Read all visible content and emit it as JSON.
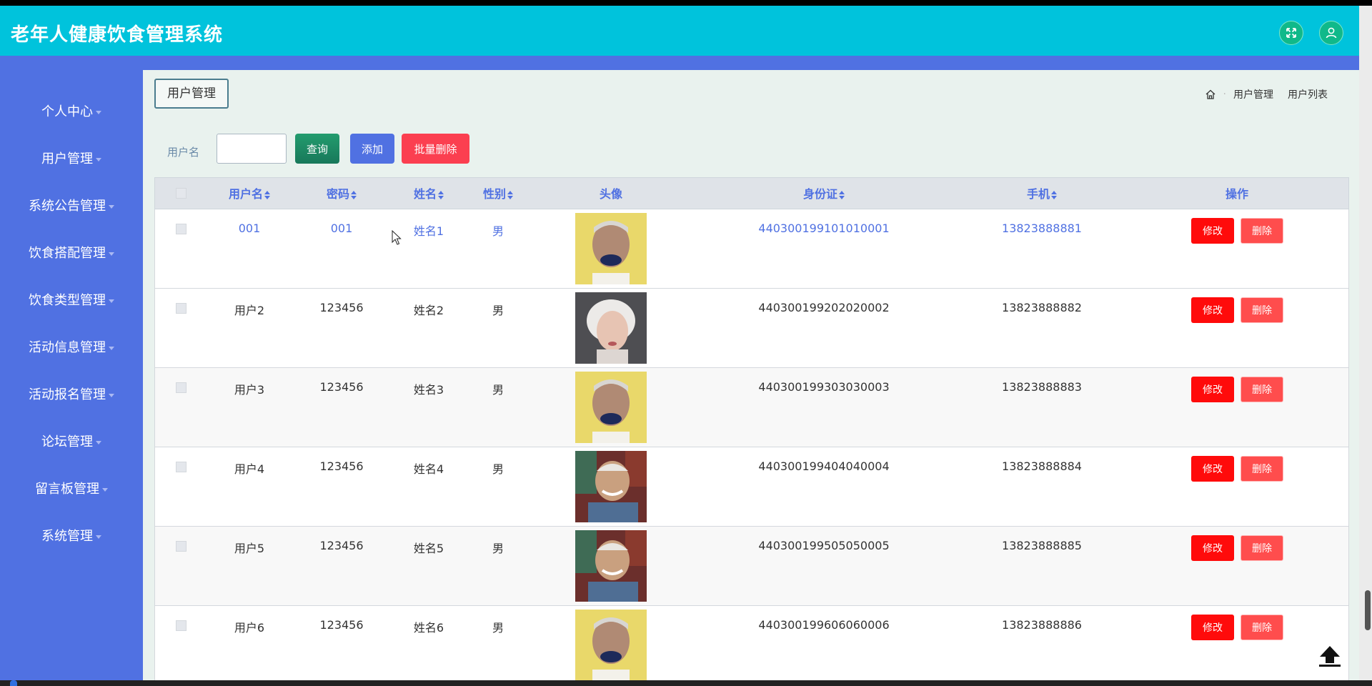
{
  "app": {
    "title": "老年人健康饮食管理系统"
  },
  "sidebar": {
    "items": [
      {
        "label": "个人中心"
      },
      {
        "label": "用户管理"
      },
      {
        "label": "系统公告管理"
      },
      {
        "label": "饮食搭配管理"
      },
      {
        "label": "饮食类型管理"
      },
      {
        "label": "活动信息管理"
      },
      {
        "label": "活动报名管理"
      },
      {
        "label": "论坛管理"
      },
      {
        "label": "留言板管理"
      },
      {
        "label": "系统管理"
      }
    ]
  },
  "page": {
    "tag": "用户管理",
    "breadcrumb": [
      "用户管理",
      "用户列表"
    ]
  },
  "filter": {
    "label": "用户名",
    "value": "",
    "query_label": "查询",
    "add_label": "添加",
    "bulk_delete_label": "批量删除"
  },
  "table": {
    "columns": [
      "用户名",
      "密码",
      "姓名",
      "性别",
      "头像",
      "身份证",
      "手机",
      "操作"
    ],
    "edit_label": "修改",
    "delete_label": "删除",
    "rows": [
      {
        "username": "001",
        "password": "001",
        "name": "姓名1",
        "gender": "男",
        "avatar": "elderly-man-yellow-bg",
        "id_card": "440300199101010001",
        "phone": "13823888881"
      },
      {
        "username": "用户2",
        "password": "123456",
        "name": "姓名2",
        "gender": "男",
        "avatar": "elderly-woman-grey-bg",
        "id_card": "440300199202020002",
        "phone": "13823888882"
      },
      {
        "username": "用户3",
        "password": "123456",
        "name": "姓名3",
        "gender": "男",
        "avatar": "elderly-man-yellow-bg",
        "id_card": "440300199303030003",
        "phone": "13823888883"
      },
      {
        "username": "用户4",
        "password": "123456",
        "name": "姓名4",
        "gender": "男",
        "avatar": "smiling-elderly-man",
        "id_card": "440300199404040004",
        "phone": "13823888884"
      },
      {
        "username": "用户5",
        "password": "123456",
        "name": "姓名5",
        "gender": "男",
        "avatar": "smiling-elderly-man",
        "id_card": "440300199505050005",
        "phone": "13823888885"
      },
      {
        "username": "用户6",
        "password": "123456",
        "name": "姓名6",
        "gender": "男",
        "avatar": "elderly-man-yellow-bg",
        "id_card": "440300199606060006",
        "phone": "13823888886"
      }
    ]
  },
  "colors": {
    "header": "#00c3dc",
    "sidebar": "#5071e2",
    "query_button": "#18785a",
    "bulk_delete_button": "#fb3f50",
    "edit_button": "#ff0b0b",
    "delete_button": "#ff4d4d"
  }
}
